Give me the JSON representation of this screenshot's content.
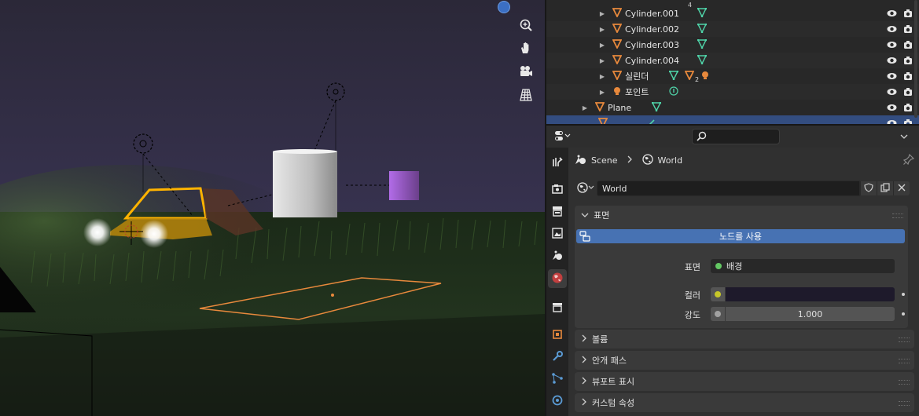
{
  "outliner": {
    "rows": [
      {
        "label": "Cylinder.001",
        "count": ""
      },
      {
        "label": "Cylinder.002",
        "count": ""
      },
      {
        "label": "Cylinder.003",
        "count": ""
      },
      {
        "label": "Cylinder.004",
        "count": ""
      },
      {
        "label": "실린더",
        "count": "2"
      },
      {
        "label": "포인트",
        "count": ""
      },
      {
        "label": "Plane",
        "count": ""
      }
    ],
    "partial_top_count": "4"
  },
  "properties": {
    "breadcrumb": {
      "scene": "Scene",
      "world": "World"
    },
    "world_name": "World",
    "surface_panel": {
      "title": "표면",
      "use_nodes_label": "노드를 사용",
      "surface_label": "표면",
      "surface_value": "배경",
      "color_label": "컬러",
      "color_value": "#1e1a2b",
      "strength_label": "강도",
      "strength_value": "1.000"
    },
    "collapsed_panels": [
      {
        "title": "볼륨"
      },
      {
        "title": "안개 패스"
      },
      {
        "title": "뷰포트 표시"
      },
      {
        "title": "커스텀 속성"
      }
    ]
  },
  "colors": {
    "accent_blue": "#4772b3",
    "selection_row": "#334d80",
    "mesh_orange": "#e8893c",
    "modifier_green": "#4fd3a8",
    "socket_green": "#63c763",
    "socket_yellow": "#c7c729",
    "socket_grey": "#a1a1a1"
  },
  "icons": [
    "zoom-icon",
    "hand-icon",
    "camera-icon",
    "grid-icon",
    "eye-icon",
    "camera-restrict-icon",
    "world-icon",
    "scene-icon",
    "pin-icon",
    "search-icon",
    "tool-icon",
    "render-icon",
    "output-icon",
    "view-layer-icon",
    "scene-props-icon",
    "world-props-icon",
    "collection-icon",
    "object-icon",
    "modifier-icon",
    "particles-icon",
    "physics-icon"
  ]
}
